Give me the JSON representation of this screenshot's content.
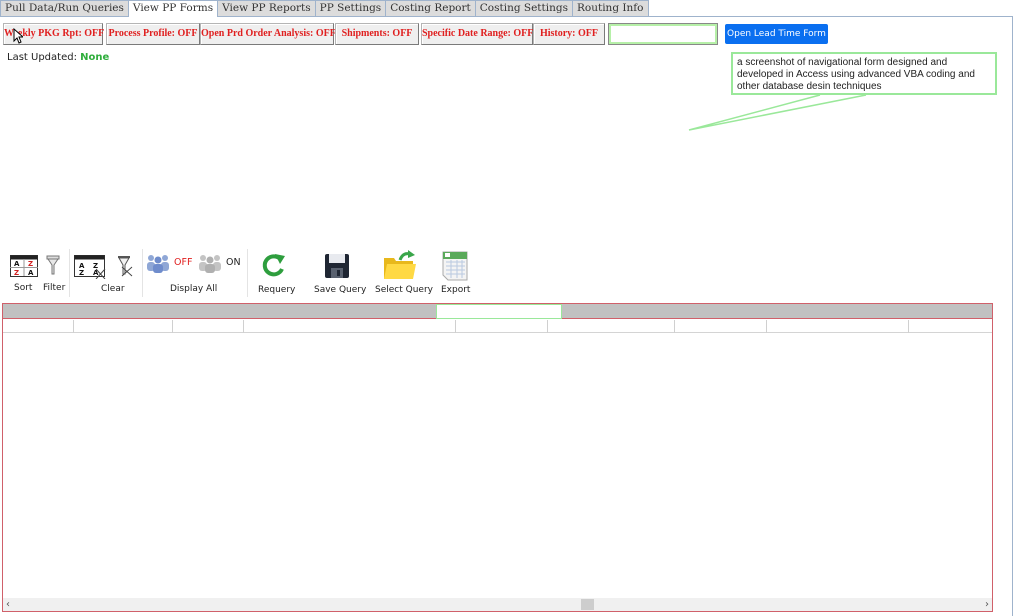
{
  "tabs": [
    {
      "label": "Pull Data/Run Queries",
      "active": false
    },
    {
      "label": "View PP Forms",
      "active": true
    },
    {
      "label": "View PP Reports",
      "active": false
    },
    {
      "label": "PP Settings",
      "active": false
    },
    {
      "label": "Costing Report",
      "active": false
    },
    {
      "label": "Costing Settings",
      "active": false
    },
    {
      "label": "Routing Info",
      "active": false
    }
  ],
  "toggles": [
    {
      "label": "Weekly PKG Rpt: OFF"
    },
    {
      "label": "Process Profile: OFF"
    },
    {
      "label": "Open Prd Order Analysis: OFF"
    },
    {
      "label": "Shipments: OFF"
    },
    {
      "label": "Specific Date Range: OFF"
    },
    {
      "label": "History: OFF"
    }
  ],
  "lead_time": {
    "input_value": "",
    "button_label": "Open Lead Time Form"
  },
  "last_updated": {
    "label": "Last Updated:",
    "value": "None"
  },
  "callout": {
    "text": "a screenshot of navigational form designed and developed in Access using advanced VBA coding and other database desin techniques"
  },
  "toolbar": {
    "sort_label": "Sort",
    "filter_label": "Filter",
    "clear_label": "Clear",
    "off_label": "OFF",
    "on_label": "ON",
    "display_all_label": "Display All",
    "requery_label": "Requery",
    "save_query_label": "Save Query",
    "select_query_label": "Select Query",
    "export_label": "Export"
  },
  "grid": {
    "filter_value": "",
    "columns": [
      "",
      "",
      "",
      "",
      "",
      "",
      "",
      "",
      "",
      ""
    ],
    "rows": []
  },
  "colors": {
    "toggle_text": "#e02020",
    "accent_button": "#0a6ff0",
    "status_green": "#2fae3c",
    "grid_border": "#d0606a",
    "callout_border": "#9ae89a"
  }
}
